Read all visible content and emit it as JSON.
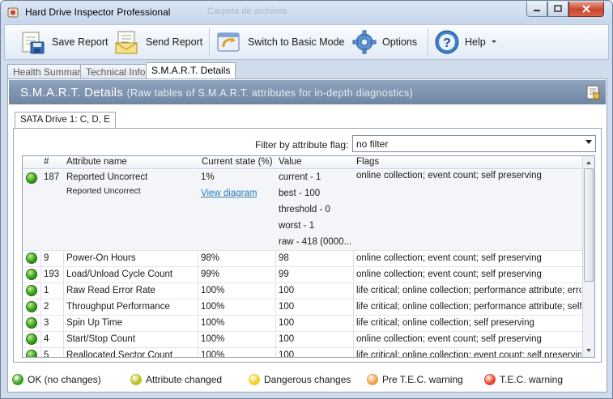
{
  "window": {
    "title": "Hard Drive Inspector Professional",
    "background_title": "Carpeta de archivos"
  },
  "toolbar": {
    "save_report": "Save Report",
    "send_report": "Send Report",
    "switch_mode": "Switch to Basic Mode",
    "options": "Options",
    "help": "Help"
  },
  "tabs": [
    "Health Summary",
    "Technical Info",
    "S.M.A.R.T. Details"
  ],
  "header": {
    "title": "S.M.A.R.T. Details",
    "subtitle": "(Raw tables of S.M.A.R.T. attributes for in-depth diagnostics)"
  },
  "drive_tab": "SATA Drive 1: C, D, E",
  "filter": {
    "label": "Filter by attribute flag:",
    "value": "no filter"
  },
  "columns": {
    "num": "#",
    "name": "Attribute name",
    "state": "Current state (%)",
    "value": "Value",
    "flags": "Flags"
  },
  "expanded_row": {
    "num": "187",
    "name": "Reported Uncorrect",
    "name_sub": "Reported Uncorrect",
    "state": "1%",
    "link": "View diagram",
    "values": [
      "current - 1",
      "best - 100",
      "threshold - 0",
      "worst - 1",
      "raw - 418 (0000..."
    ],
    "flags": "online collection; event count; self preserving"
  },
  "rows": [
    {
      "num": "9",
      "name": "Power-On Hours",
      "state": "98%",
      "value": "98",
      "flags": "online collection; event count; self preserving"
    },
    {
      "num": "193",
      "name": "Load/Unload Cycle Count",
      "state": "99%",
      "value": "99",
      "flags": "online collection; event count; self preserving"
    },
    {
      "num": "1",
      "name": "Raw Read Error Rate",
      "state": "100%",
      "value": "100",
      "flags": "life critical; online collection; performance attribute; error ..."
    },
    {
      "num": "2",
      "name": "Throughput Performance",
      "state": "100%",
      "value": "100",
      "flags": "life critical; online collection; performance attribute; self p..."
    },
    {
      "num": "3",
      "name": "Spin Up Time",
      "state": "100%",
      "value": "100",
      "flags": "life critical; online collection; self preserving"
    },
    {
      "num": "4",
      "name": "Start/Stop Count",
      "state": "100%",
      "value": "100",
      "flags": "online collection; event count; self preserving"
    },
    {
      "num": "5",
      "name": "Reallocated Sector Count",
      "state": "100%",
      "value": "100",
      "flags": "life critical; online collection; event count; self preserving"
    }
  ],
  "legend": [
    {
      "label": "OK (no changes)",
      "color": "#3ba21d"
    },
    {
      "label": "Attribute changed",
      "color": "#b8c424"
    },
    {
      "label": "Dangerous changes",
      "color": "#f2d021"
    },
    {
      "label": "Pre T.E.C. warning",
      "color": "#f0a24a"
    },
    {
      "label": "T.E.C. warning",
      "color": "#e84a2e"
    }
  ]
}
